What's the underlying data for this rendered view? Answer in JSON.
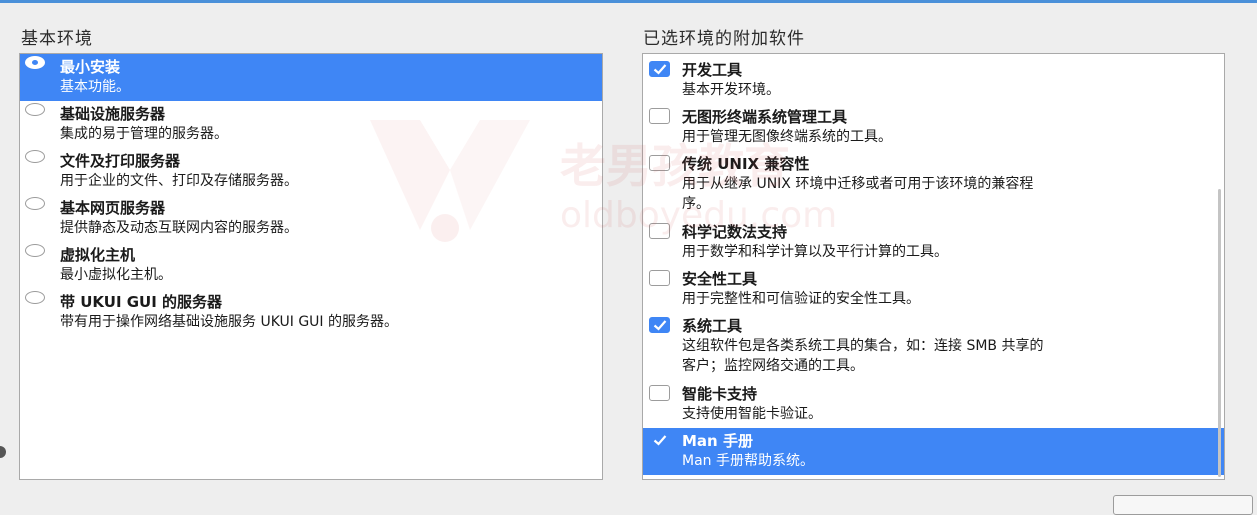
{
  "left_section": {
    "title": "基本环境",
    "items": [
      {
        "title": "最小安装",
        "desc": "基本功能。",
        "selected": true
      },
      {
        "title": "基础设施服务器",
        "desc": "集成的易于管理的服务器。",
        "selected": false
      },
      {
        "title": "文件及打印服务器",
        "desc": "用于企业的文件、打印及存储服务器。",
        "selected": false
      },
      {
        "title": "基本网页服务器",
        "desc": "提供静态及动态互联网内容的服务器。",
        "selected": false
      },
      {
        "title": "虚拟化主机",
        "desc": "最小虚拟化主机。",
        "selected": false
      },
      {
        "title": "带 UKUI GUI 的服务器",
        "desc": "带有用于操作网络基础设施服务 UKUI GUI 的服务器。",
        "selected": false
      }
    ]
  },
  "right_section": {
    "title": "已选环境的附加软件",
    "items": [
      {
        "title": "开发工具",
        "desc": [
          "基本开发环境。"
        ],
        "checked": true,
        "highlighted": false
      },
      {
        "title": "无图形终端系统管理工具",
        "desc": [
          "用于管理无图像终端系统的工具。"
        ],
        "checked": false,
        "highlighted": false
      },
      {
        "title": "传统 UNIX 兼容性",
        "desc": [
          "用于从继承 UNIX 环境中迁移或者可用于该环境的兼容程",
          "序。"
        ],
        "checked": false,
        "highlighted": false
      },
      {
        "title": "科学记数法支持",
        "desc": [
          "用于数学和科学计算以及平行计算的工具。"
        ],
        "checked": false,
        "highlighted": false
      },
      {
        "title": "安全性工具",
        "desc": [
          "用于完整性和可信验证的安全性工具。"
        ],
        "checked": false,
        "highlighted": false
      },
      {
        "title": "系统工具",
        "desc": [
          "这组软件包是各类系统工具的集合，如：连接 SMB 共享的",
          "客户；监控网络交通的工具。"
        ],
        "checked": true,
        "highlighted": false
      },
      {
        "title": "智能卡支持",
        "desc": [
          "支持使用智能卡验证。"
        ],
        "checked": false,
        "highlighted": false
      },
      {
        "title": "Man 手册",
        "desc": [
          "Man 手册帮助系统。"
        ],
        "checked": true,
        "highlighted": true
      }
    ]
  },
  "watermark": {
    "line1": "老男孩教育",
    "line2": "oldboyedu.com"
  },
  "colors": {
    "accent": "#3f86f5",
    "check": "#3f86f5",
    "watermark": "#d25050"
  }
}
